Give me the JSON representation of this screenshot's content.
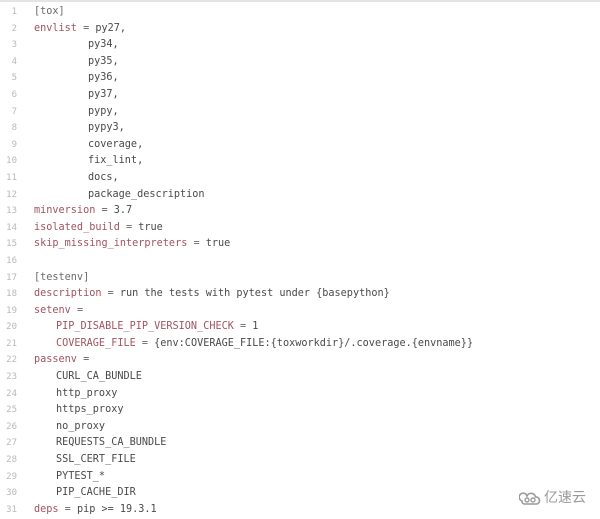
{
  "editor": {
    "language": "ini",
    "lines": [
      {
        "n": "1",
        "indent": 0,
        "tokens": [
          {
            "t": "section",
            "v": "[tox]"
          }
        ]
      },
      {
        "n": "2",
        "indent": 0,
        "tokens": [
          {
            "t": "key",
            "v": "envlist"
          },
          {
            "t": "op",
            "v": " = "
          },
          {
            "t": "val",
            "v": "py27,"
          }
        ]
      },
      {
        "n": "3",
        "indent": 2,
        "tokens": [
          {
            "t": "val",
            "v": "py34,"
          }
        ]
      },
      {
        "n": "4",
        "indent": 2,
        "tokens": [
          {
            "t": "val",
            "v": "py35,"
          }
        ]
      },
      {
        "n": "5",
        "indent": 2,
        "tokens": [
          {
            "t": "val",
            "v": "py36,"
          }
        ]
      },
      {
        "n": "6",
        "indent": 2,
        "tokens": [
          {
            "t": "val",
            "v": "py37,"
          }
        ]
      },
      {
        "n": "7",
        "indent": 2,
        "tokens": [
          {
            "t": "val",
            "v": "pypy,"
          }
        ]
      },
      {
        "n": "8",
        "indent": 2,
        "tokens": [
          {
            "t": "val",
            "v": "pypy3,"
          }
        ]
      },
      {
        "n": "9",
        "indent": 2,
        "tokens": [
          {
            "t": "val",
            "v": "coverage,"
          }
        ]
      },
      {
        "n": "10",
        "indent": 2,
        "tokens": [
          {
            "t": "val",
            "v": "fix_lint,"
          }
        ]
      },
      {
        "n": "11",
        "indent": 2,
        "tokens": [
          {
            "t": "val",
            "v": "docs,"
          }
        ]
      },
      {
        "n": "12",
        "indent": 2,
        "tokens": [
          {
            "t": "val",
            "v": "package_description"
          }
        ]
      },
      {
        "n": "13",
        "indent": 0,
        "tokens": [
          {
            "t": "key",
            "v": "minversion"
          },
          {
            "t": "op",
            "v": " = "
          },
          {
            "t": "val",
            "v": "3.7"
          }
        ]
      },
      {
        "n": "14",
        "indent": 0,
        "tokens": [
          {
            "t": "key",
            "v": "isolated_build"
          },
          {
            "t": "op",
            "v": " = "
          },
          {
            "t": "val",
            "v": "true"
          }
        ]
      },
      {
        "n": "15",
        "indent": 0,
        "tokens": [
          {
            "t": "key",
            "v": "skip_missing_interpreters"
          },
          {
            "t": "op",
            "v": " = "
          },
          {
            "t": "val",
            "v": "true"
          }
        ]
      },
      {
        "n": "16",
        "indent": 0,
        "tokens": []
      },
      {
        "n": "17",
        "indent": 0,
        "tokens": [
          {
            "t": "section",
            "v": "[testenv]"
          }
        ]
      },
      {
        "n": "18",
        "indent": 0,
        "tokens": [
          {
            "t": "key",
            "v": "description"
          },
          {
            "t": "op",
            "v": " = "
          },
          {
            "t": "val",
            "v": "run the tests with pytest under {basepython}"
          }
        ]
      },
      {
        "n": "19",
        "indent": 0,
        "tokens": [
          {
            "t": "key",
            "v": "setenv"
          },
          {
            "t": "op",
            "v": " ="
          }
        ]
      },
      {
        "n": "20",
        "indent": 1,
        "tokens": [
          {
            "t": "key",
            "v": "PIP_DISABLE_PIP_VERSION_CHECK"
          },
          {
            "t": "op",
            "v": " = "
          },
          {
            "t": "val",
            "v": "1"
          }
        ]
      },
      {
        "n": "21",
        "indent": 1,
        "tokens": [
          {
            "t": "key",
            "v": "COVERAGE_FILE"
          },
          {
            "t": "op",
            "v": " = "
          },
          {
            "t": "val",
            "v": "{env:COVERAGE_FILE:{toxworkdir}/.coverage.{envname}}"
          }
        ]
      },
      {
        "n": "22",
        "indent": 0,
        "tokens": [
          {
            "t": "key",
            "v": "passenv"
          },
          {
            "t": "op",
            "v": " ="
          }
        ]
      },
      {
        "n": "23",
        "indent": 1,
        "tokens": [
          {
            "t": "val",
            "v": "CURL_CA_BUNDLE"
          }
        ]
      },
      {
        "n": "24",
        "indent": 1,
        "tokens": [
          {
            "t": "val",
            "v": "http_proxy"
          }
        ]
      },
      {
        "n": "25",
        "indent": 1,
        "tokens": [
          {
            "t": "val",
            "v": "https_proxy"
          }
        ]
      },
      {
        "n": "26",
        "indent": 1,
        "tokens": [
          {
            "t": "val",
            "v": "no_proxy"
          }
        ]
      },
      {
        "n": "27",
        "indent": 1,
        "tokens": [
          {
            "t": "val",
            "v": "REQUESTS_CA_BUNDLE"
          }
        ]
      },
      {
        "n": "28",
        "indent": 1,
        "tokens": [
          {
            "t": "val",
            "v": "SSL_CERT_FILE"
          }
        ]
      },
      {
        "n": "29",
        "indent": 1,
        "tokens": [
          {
            "t": "val",
            "v": "PYTEST_*"
          }
        ]
      },
      {
        "n": "30",
        "indent": 1,
        "tokens": [
          {
            "t": "val",
            "v": "PIP_CACHE_DIR"
          }
        ]
      },
      {
        "n": "31",
        "indent": 0,
        "tokens": [
          {
            "t": "key",
            "v": "deps"
          },
          {
            "t": "op",
            "v": " = "
          },
          {
            "t": "val",
            "v": "pip >= 19.3.1"
          }
        ]
      }
    ]
  },
  "watermark": {
    "icon": "cloud-logo-icon",
    "text": "亿速云"
  }
}
